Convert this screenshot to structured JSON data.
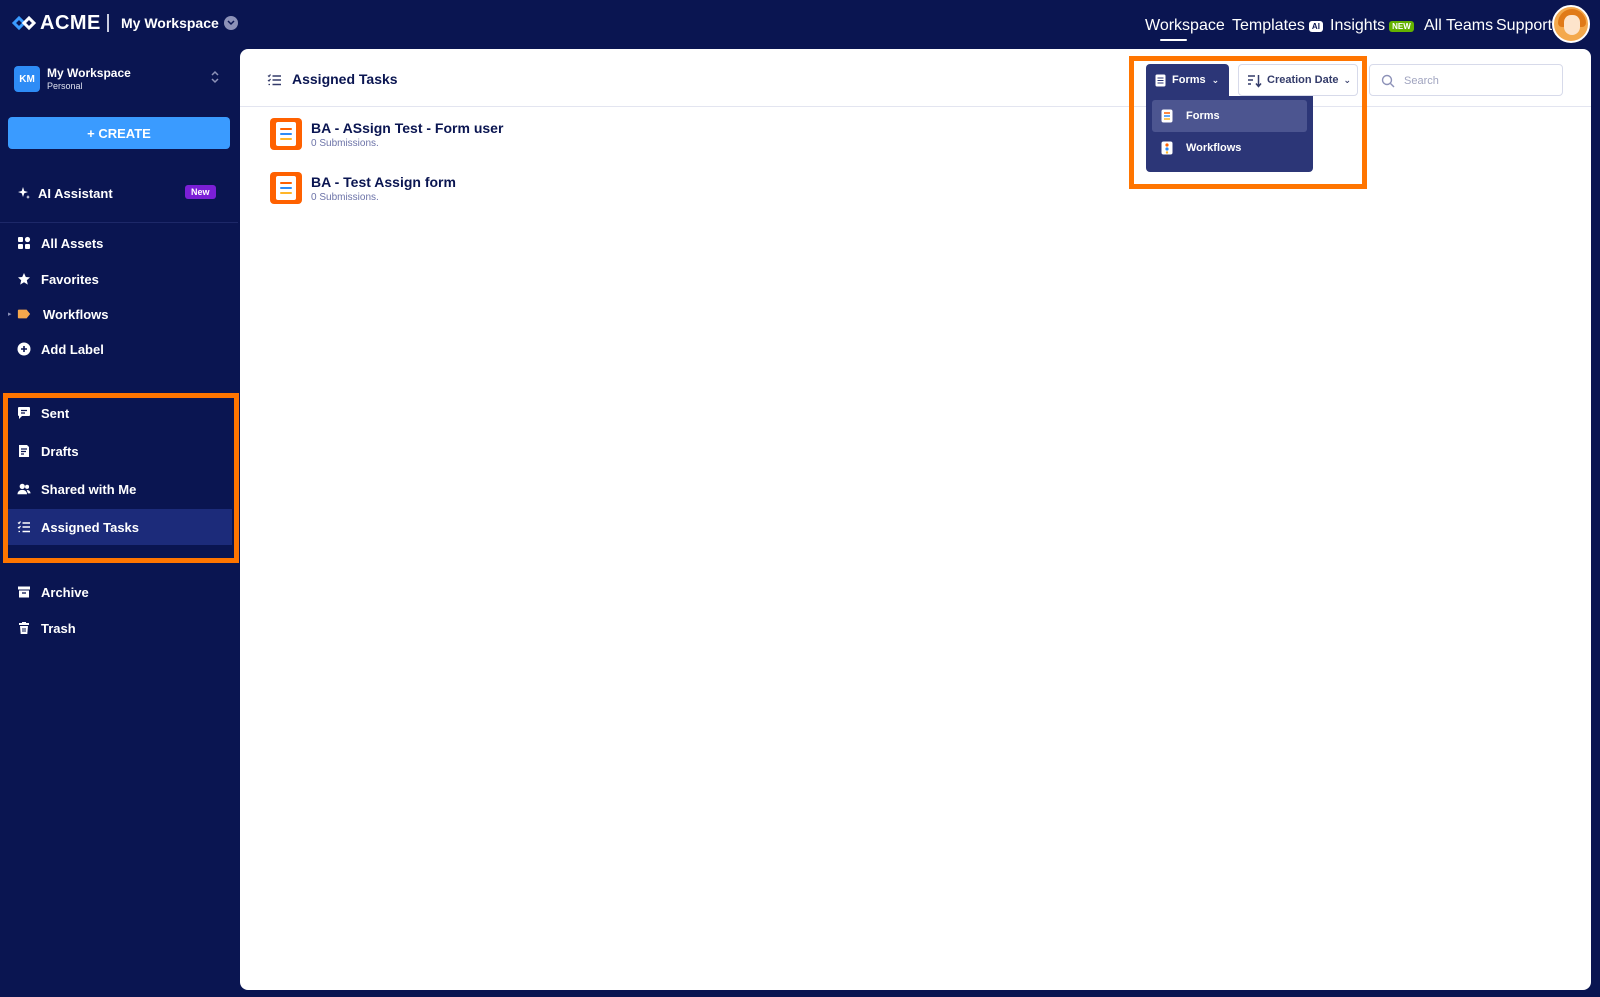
{
  "header": {
    "logo_text": "ACME",
    "workspace_title": "My Workspace",
    "nav": [
      {
        "label": "Workspace",
        "active": true
      },
      {
        "label": "Templates",
        "badge": "AI"
      },
      {
        "label": "Insights",
        "badge": "NEW"
      },
      {
        "label": "All Teams"
      },
      {
        "label": "Support"
      }
    ]
  },
  "sidebar": {
    "workspace": {
      "initials": "KM",
      "name": "My Workspace",
      "type": "Personal"
    },
    "create_label": "+ CREATE",
    "ai_assistant": {
      "label": "AI Assistant",
      "badge": "New"
    },
    "items": [
      {
        "label": "All Assets",
        "icon": "grid-icon"
      },
      {
        "label": "Favorites",
        "icon": "star-icon"
      },
      {
        "label": "Workflows",
        "icon": "label-tag-icon"
      },
      {
        "label": "Add Label",
        "icon": "plus-circle-icon"
      }
    ],
    "shared_items": [
      {
        "label": "Sent",
        "icon": "message-icon"
      },
      {
        "label": "Drafts",
        "icon": "draft-icon"
      },
      {
        "label": "Shared with Me",
        "icon": "users-icon"
      },
      {
        "label": "Assigned Tasks",
        "icon": "task-list-icon",
        "active": true
      }
    ],
    "bottom_items": [
      {
        "label": "Archive",
        "icon": "archive-icon"
      },
      {
        "label": "Trash",
        "icon": "trash-icon"
      }
    ]
  },
  "main": {
    "title": "Assigned Tasks",
    "filter": {
      "label": "Forms",
      "options": [
        "Forms",
        "Workflows"
      ],
      "selected": "Forms"
    },
    "sort": {
      "label": "Creation Date"
    },
    "search": {
      "placeholder": "Search"
    },
    "tasks": [
      {
        "title": "BA - ASsign Test - Form user",
        "subtitle": "0 Submissions."
      },
      {
        "title": "BA - Test Assign form",
        "subtitle": "0 Submissions."
      }
    ]
  },
  "colors": {
    "background": "#0a1551",
    "accent": "#3a9bff",
    "highlight": "#ff7500",
    "form_icon": "#ff6100",
    "new_badge": "#7b1fd6",
    "insights_badge": "#64b200"
  }
}
